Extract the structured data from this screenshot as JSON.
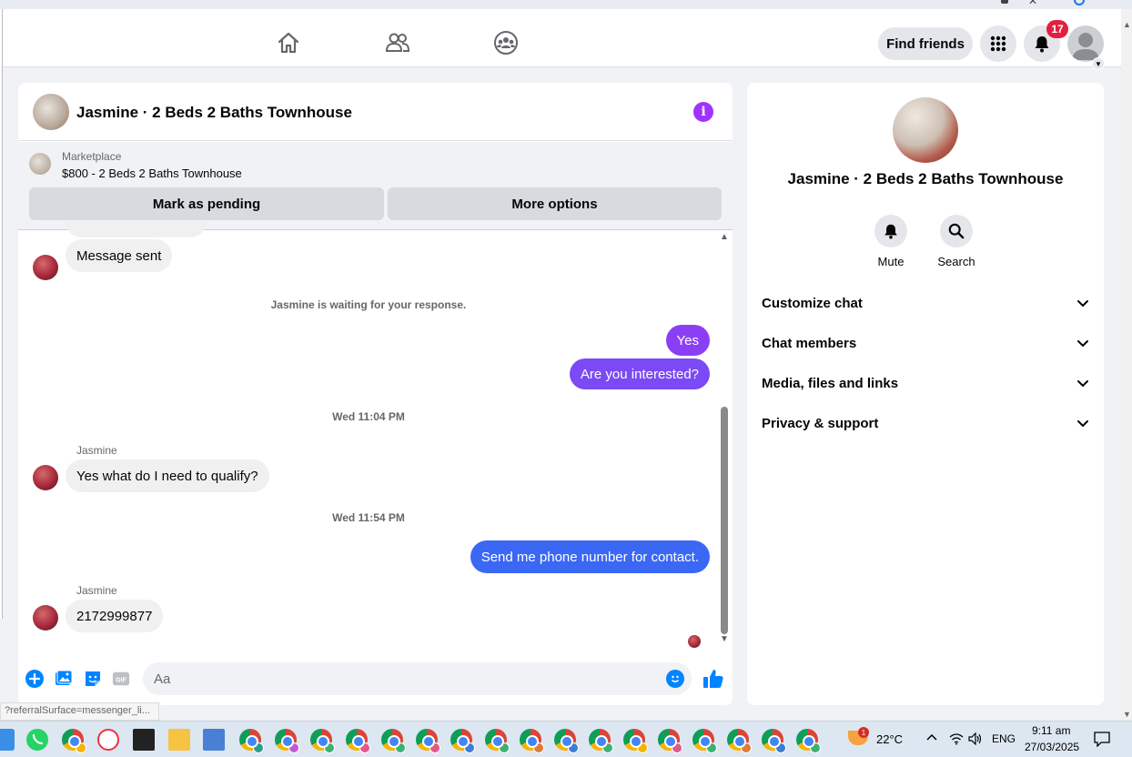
{
  "nav": {
    "find_friends_label": "Find friends",
    "notification_count": "17"
  },
  "chat": {
    "title": "Jasmine · 2 Beds 2 Baths Townhouse",
    "marketplace": {
      "label": "Marketplace",
      "listing": "$800 - 2 Beds 2 Baths Townhouse",
      "mark_pending_label": "Mark as pending",
      "more_options_label": "More options"
    },
    "messages": {
      "msg1": "Message sent",
      "waiting_note": "Jasmine is waiting for your response.",
      "msg_yes": "Yes",
      "msg_interested": "Are you interested?",
      "time1": "Wed 11:04 PM",
      "sender1": "Jasmine",
      "msg_qualify": "Yes what do I need to qualify?",
      "time2": "Wed 11:54 PM",
      "msg_phone_request": "Send me phone number for contact.",
      "sender2": "Jasmine",
      "msg_phone": "2172999877"
    },
    "composer": {
      "placeholder": "Aa"
    },
    "colors": {
      "purple_bubble": "#8b3ff5",
      "blue_bubble": "#3b67f5",
      "accent": "#0084ff"
    }
  },
  "info": {
    "name": "Jasmine · 2 Beds 2 Baths Townhouse",
    "mute_label": "Mute",
    "search_label": "Search",
    "sections": [
      "Customize chat",
      "Chat members",
      "Media, files and links",
      "Privacy & support"
    ]
  },
  "status_url": "?referralSurface=messenger_li...",
  "taskbar": {
    "weather_badge": "1",
    "temperature": "22°C",
    "language": "ENG",
    "time": "9:11 am",
    "date": "27/03/2025"
  }
}
